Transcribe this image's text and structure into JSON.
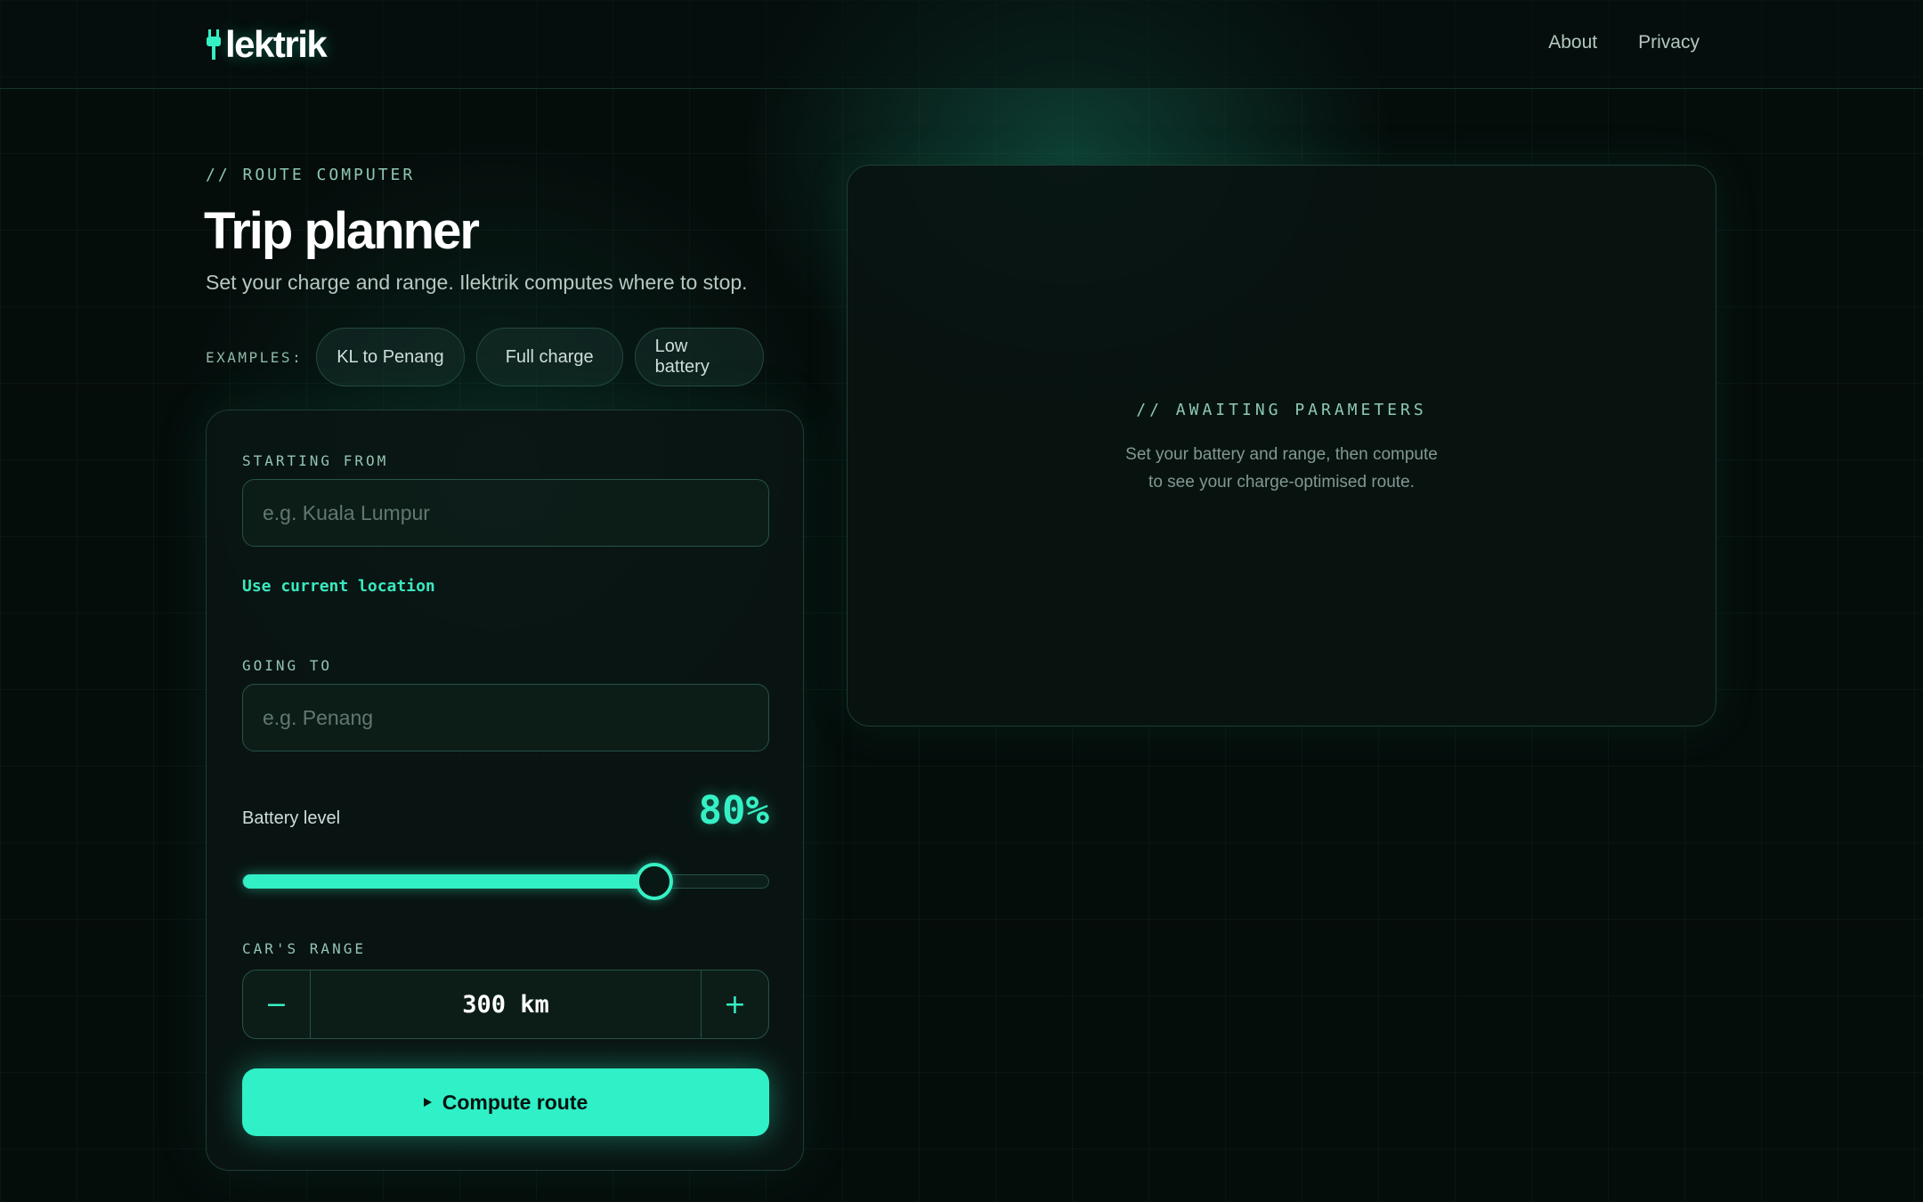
{
  "brand": {
    "name": "lektrik",
    "icon": "plug-icon",
    "accent": "#2ff0c7"
  },
  "nav": {
    "about": "About",
    "privacy": "Privacy"
  },
  "hero": {
    "eyebrow": "// ROUTE COMPUTER",
    "title": "Trip planner",
    "subtitle": "Set your charge and range. Ilektrik computes where to stop."
  },
  "examples": {
    "label": "EXAMPLES:",
    "items": [
      "KL to Penang",
      "Full charge",
      "Low battery"
    ]
  },
  "form": {
    "start": {
      "label": "STARTING FROM",
      "placeholder": "e.g. Kuala Lumpur",
      "value": ""
    },
    "use_location": "Use current location",
    "destination": {
      "label": "GOING TO",
      "placeholder": "e.g. Penang",
      "value": ""
    },
    "battery": {
      "label": "Battery level",
      "value_text": "80%",
      "value": 80
    },
    "range": {
      "label": "CAR'S RANGE",
      "value": "300 km",
      "minus": "−",
      "plus": "+"
    },
    "submit": "Compute route"
  },
  "result": {
    "title": "// AWAITING PARAMETERS",
    "line1": "Set your battery and range, then compute",
    "line2": "to see your charge-optimised route."
  }
}
